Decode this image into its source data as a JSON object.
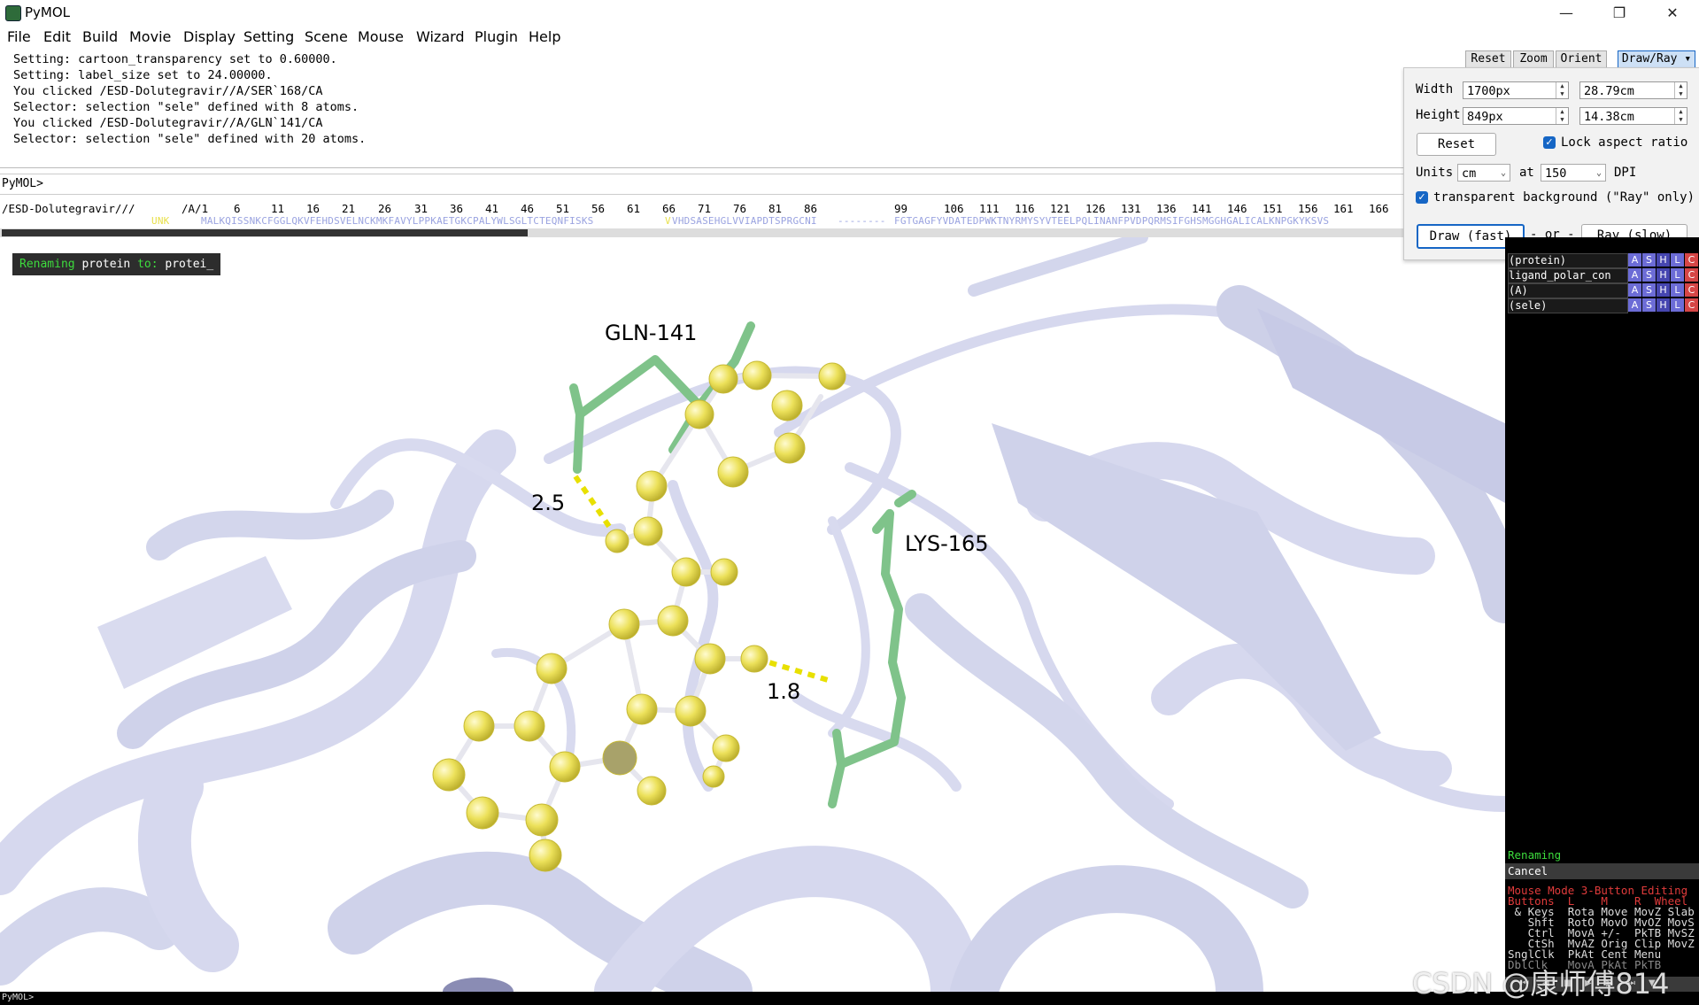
{
  "window": {
    "title": "PyMOL",
    "min_icon": "minimize-icon",
    "max_icon": "restore-icon",
    "close_icon": "close-icon"
  },
  "menu": [
    "File",
    "Edit",
    "Build",
    "Movie",
    "Display",
    "Setting",
    "Scene",
    "Mouse",
    "Wizard",
    "Plugin",
    "Help"
  ],
  "log": [
    "Setting: cartoon_transparency set to 0.60000.",
    "Setting: label_size set to 24.00000.",
    "You clicked /ESD-Dolutegravir//A/SER`168/CA",
    "Selector: selection \"sele\" defined with 8 atoms.",
    "You clicked /ESD-Dolutegravir//A/GLN`141/CA",
    "Selector: selection \"sele\" defined with 20 atoms."
  ],
  "command": {
    "prompt": "PyMOL>",
    "value": ""
  },
  "sequence": {
    "object_label": "/ESD-Dolutegravir///",
    "chain_label": "/A/1",
    "numbers": [
      "6",
      "11",
      "16",
      "21",
      "26",
      "31",
      "36",
      "41",
      "46",
      "51",
      "56",
      "61",
      "66",
      "71",
      "76",
      "81",
      "86",
      "99",
      "106",
      "111",
      "116",
      "121",
      "126",
      "131",
      "136",
      "141",
      "146",
      "151",
      "156",
      "161",
      "166"
    ],
    "ligand_residue": "UNK",
    "residues_1": "MALKQISSNKCFGGLQKVFEHDSVELNCKMKFAVYLPPKAETGKCPALYWLSGLTCTEQNFISKS",
    "residues_2": "VHDSASEHGLVVIAPDTSPRGCNI",
    "gap": "--------",
    "residues_3": "FGTGAGFYVDATEDPWKTNYRMYSYVTEELPQLINANFPVDPQRMSIFGHSMGGHGALICALKNPGKYKSVS"
  },
  "viewport": {
    "status_prefix": "Renaming",
    "status_middle": " protein ",
    "status_to": "to:",
    "status_value": " protei_",
    "labels": {
      "gln": "GLN-141",
      "lys": "LYS-165",
      "dist1": "2.5",
      "dist2": "1.8"
    }
  },
  "top_buttons": [
    "Reset",
    "Zoom",
    "Orient",
    "Draw/Ray"
  ],
  "draw_ray": {
    "width_label": "Width",
    "width_px": "1700px",
    "width_cm": "28.79cm",
    "height_label": "Height",
    "height_px": "849px",
    "height_cm": "14.38cm",
    "reset": "Reset",
    "lock": "Lock aspect ratio",
    "units_label": "Units",
    "units_value": "cm",
    "at_label": "at",
    "dpi_value": "150",
    "dpi_label": "DPI",
    "transparent": "transparent background (\"Ray\" only)",
    "draw_btn": "Draw (fast)",
    "or_label": "- or -",
    "ray_btn": "Ray (slow)"
  },
  "objects": [
    {
      "name": "(protein)"
    },
    {
      "name": "ligand_polar_con"
    },
    {
      "name": "(A)"
    },
    {
      "name": "(sele)"
    }
  ],
  "ashlc": [
    "A",
    "S",
    "H",
    "L",
    "C"
  ],
  "right_panel": {
    "renaming": "Renaming",
    "cancel": "Cancel",
    "mode_line": "Mouse Mode 3-Button Editing",
    "buttons_line": "Buttons  L    M    R  Wheel",
    "keys_line": " & Keys  Rota Move MovZ Slab",
    "shft_line": "   Shft  RotO MovO MvOZ MovS",
    "ctrl_line": "   Ctrl  MovA +/-  PkTB MvSZ",
    "ctsh_line": "   CtSh  MvAZ Orig Clip MovZ",
    "sngl_line": "SnglClk  PkAt Cent Menu",
    "dbl_line": "DblClk   MovA PkAt PkTB"
  },
  "bottom": {
    "prompt": "PyMOL>"
  },
  "watermark": "CSDN @康师傅814",
  "colors": {
    "cartoon": "#d6d8ee",
    "ligand": "#e8e04a",
    "residue": "#7fc38a",
    "hbond": "#e8e000"
  }
}
